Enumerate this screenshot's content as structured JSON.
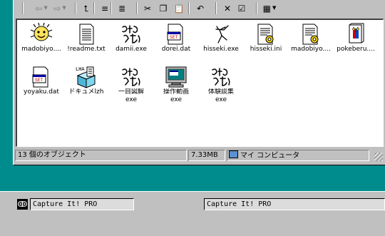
{
  "toolbar": {
    "buttons": [
      {
        "name": "back-button",
        "glyph": "⇦",
        "dim": true,
        "dropdown": true
      },
      {
        "name": "forward-button",
        "glyph": "⇨",
        "dim": true,
        "dropdown": true
      },
      {
        "name": "up-folder-button",
        "glyph": "⮤"
      },
      {
        "name": "map-drive-button",
        "glyph": "≡"
      },
      {
        "name": "disconnect-drive-button",
        "glyph": "≣"
      },
      {
        "name": "cut-button",
        "glyph": "✂"
      },
      {
        "name": "copy-button",
        "glyph": "❐"
      },
      {
        "name": "paste-button",
        "glyph": "📋"
      },
      {
        "name": "undo-button",
        "glyph": "↶"
      },
      {
        "name": "delete-button",
        "glyph": "✕"
      },
      {
        "name": "properties-button",
        "glyph": "☑"
      },
      {
        "name": "views-button",
        "glyph": "▦",
        "dropdown": true
      }
    ]
  },
  "files": [
    {
      "label": "madobiyo....",
      "icon": "smiley-face-icon"
    },
    {
      "label": "!readme.txt",
      "icon": "text-document-icon"
    },
    {
      "label": "damii.exe",
      "icon": "calligraphy-exe-icon"
    },
    {
      "label": "dorei.dat",
      "icon": "data-file-icon"
    },
    {
      "label": "hisseki.exe",
      "icon": "stick-figure-exe-icon"
    },
    {
      "label": "hisseki.ini",
      "icon": "settings-file-icon"
    },
    {
      "label": "madobiyo....",
      "icon": "settings-file-icon"
    },
    {
      "label": "pokeberu....",
      "icon": "help-book-icon"
    },
    {
      "label": "yoyaku.dat",
      "icon": "data-file-icon"
    },
    {
      "label": "ドキュメlzh",
      "icon": "lzh-archive-icon"
    },
    {
      "label": "一目図解",
      "sub": "exe",
      "icon": "calligraphy-exe-icon"
    },
    {
      "label": "操作動画",
      "sub": "exe",
      "icon": "monitor-exe-icon"
    },
    {
      "label": "体験談集",
      "sub": "exe",
      "icon": "calligraphy-exe-icon"
    }
  ],
  "statusbar": {
    "objects": "13 個のオブジェクト",
    "size": "7.33MB",
    "location": "マイ コンピュータ"
  },
  "taskbar": {
    "items": [
      "Capture It! PRO",
      "Capture It! PRO"
    ]
  }
}
